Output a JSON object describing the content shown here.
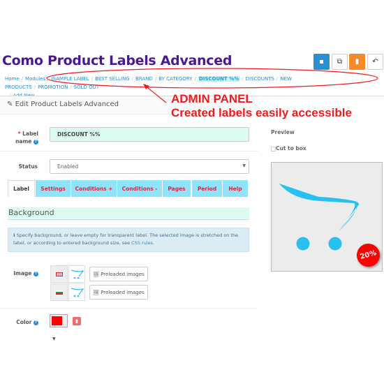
{
  "header": {
    "title": "Como Product Labels Advanced",
    "buttons": [
      {
        "name": "save",
        "icon": "save-icon",
        "color": "#2a8fd4"
      },
      {
        "name": "copy",
        "icon": "copy-icon",
        "color": "#ffffff"
      },
      {
        "name": "delete",
        "icon": "trash-icon",
        "color": "#f58a2a"
      },
      {
        "name": "back",
        "icon": "back-arrow-icon",
        "color": "#ffffff"
      }
    ]
  },
  "breadcrumb": {
    "items": [
      "Home",
      "Modules",
      "ISAMPLE LABEL",
      "BEST SELLING",
      "BRAND",
      "BY CATEGORY",
      "DISCOUNT %%",
      "DISCOUNTS",
      "NEW PRODUCTS",
      "PROMOTION",
      "SOLD OUT",
      "Add New"
    ],
    "current": "DISCOUNT %%"
  },
  "annotation": {
    "line1": "ADMIN PANEL",
    "line2": "Created labels easily accessible",
    "color": "#f21b1b"
  },
  "panel": {
    "heading": "Edit Product Labels Advanced"
  },
  "form": {
    "label_name": {
      "required": "*",
      "label": "Label name",
      "value": "DISCOUNT %%"
    },
    "status": {
      "label": "Status",
      "value": "Enabled"
    },
    "tabs": [
      "Label",
      "Settings",
      "Conditions +",
      "Conditions -",
      "Pages",
      "Period",
      "Help"
    ],
    "active_tab": "Label",
    "section": "Background",
    "info": {
      "text": "Specify background, or leave empty for transparent label. The selected image is stretched on the label, or according to entered background size, see ",
      "link": "CSS rules",
      "end": "."
    },
    "image": {
      "label": "Image",
      "rows": [
        {
          "flag": "en",
          "button": "Preloaded images"
        },
        {
          "flag": "bg",
          "button": "Preloaded images"
        }
      ]
    },
    "color": {
      "label": "Color",
      "value": "#ff0000"
    }
  },
  "preview": {
    "title": "Preview",
    "cut_to_box": "Cut to box",
    "cut_checked": false,
    "badge": "20%"
  }
}
